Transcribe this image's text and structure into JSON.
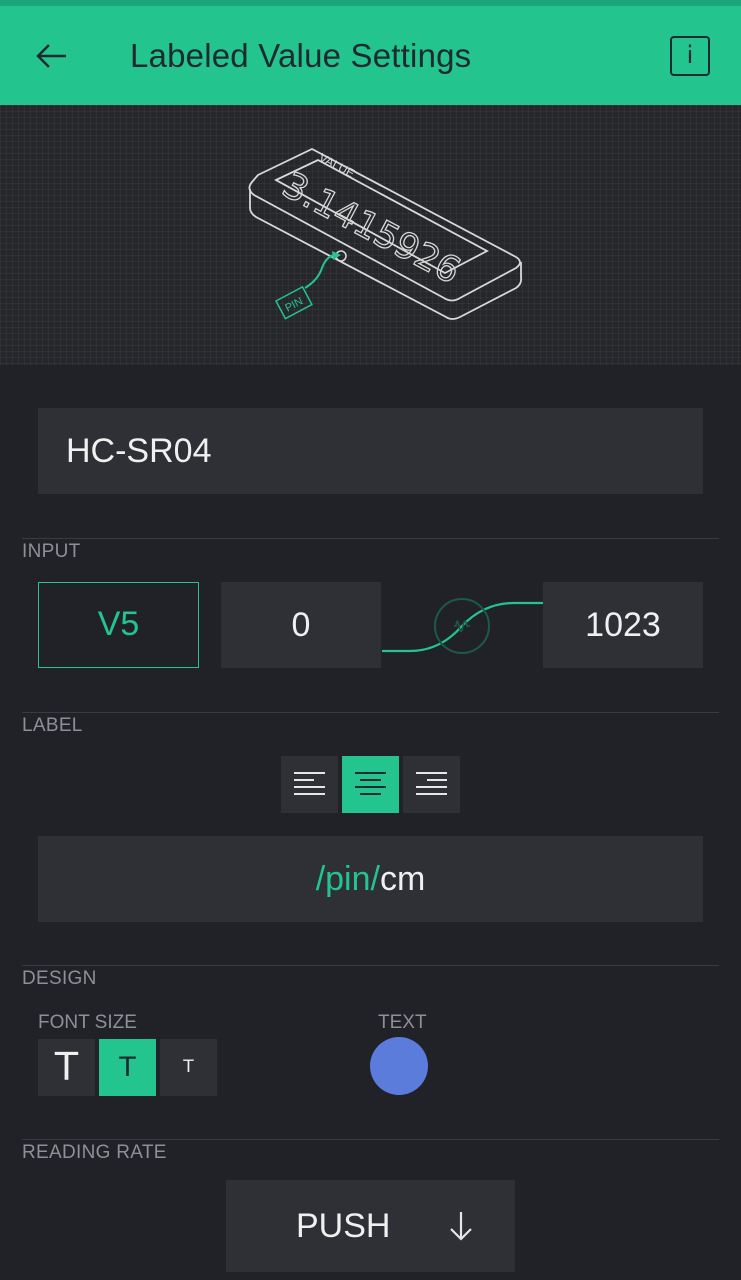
{
  "header": {
    "title": "Labeled Value Settings",
    "back_icon": "arrow-left-icon",
    "info_label": "i",
    "info_icon": "info-icon"
  },
  "hero": {
    "value_caption": "VALUE",
    "value_display": "3.1415926",
    "pin_caption": "PIN"
  },
  "name_field": {
    "value": "HC-SR04"
  },
  "input": {
    "section_label": "INPUT",
    "pin": "V5",
    "min": "0",
    "max": "1023"
  },
  "label": {
    "section_label": "LABEL",
    "alignment_options": [
      "left",
      "center",
      "right"
    ],
    "selected_alignment": "center",
    "value_pin_part": "/pin/",
    "value_unit_part": "cm"
  },
  "design": {
    "section_label": "DESIGN",
    "font_size_label": "FONT SIZE",
    "font_sizes": [
      "T",
      "T",
      "T"
    ],
    "selected_font_size": 1,
    "text_color_label": "TEXT",
    "text_color": "#5c7cdc"
  },
  "reading_rate": {
    "section_label": "READING RATE",
    "value": "PUSH",
    "dropdown_icon": "arrow-down-icon"
  },
  "colors": {
    "accent": "#23c48e",
    "background": "#212227",
    "field": "#2f3035"
  }
}
